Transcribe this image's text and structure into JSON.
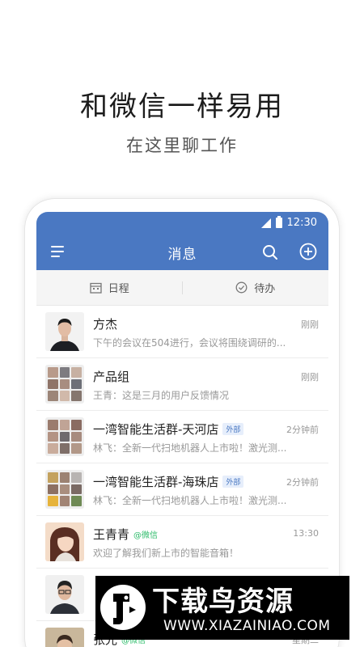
{
  "hero": {
    "title": "和微信一样易用",
    "subtitle": "在这里聊工作"
  },
  "status": {
    "time": "12:30"
  },
  "header": {
    "title": "消息"
  },
  "tabs": [
    {
      "label": "日程",
      "icon": "calendar-icon"
    },
    {
      "label": "待办",
      "icon": "check-circle-icon"
    }
  ],
  "messages": [
    {
      "name": "方杰",
      "time": "刚刚",
      "preview": "下午的会议在504进行，会议将围绕调研的...",
      "tag": ""
    },
    {
      "name": "产品组",
      "time": "刚刚",
      "preview": "王青：这是三月的用户反馈情况",
      "tag": ""
    },
    {
      "name": "一湾智能生活群-天河店",
      "time": "2分钟前",
      "preview": "林飞：全新一代扫地机器人上市啦！激光测...",
      "tag": "外部"
    },
    {
      "name": "一湾智能生活群-海珠店",
      "time": "2分钟前",
      "preview": "林飞：全新一代扫地机器人上市啦！激光测...",
      "tag": "外部"
    },
    {
      "name": "王青青",
      "time": "13:30",
      "preview": "欢迎了解我们新上市的智能音箱！",
      "tag_wechat": "@微信"
    },
    {
      "name": "",
      "time": "",
      "preview": "",
      "tag": ""
    },
    {
      "name": "张光",
      "time": "星期二",
      "preview": "",
      "tag_wechat": "@微信"
    }
  ],
  "watermark": {
    "title": "下载鸟资源",
    "url": "WWW.XIAZAINIAO.COM"
  },
  "colors": {
    "accent": "#4a78c2",
    "wechat_green": "#2dbb6a"
  }
}
